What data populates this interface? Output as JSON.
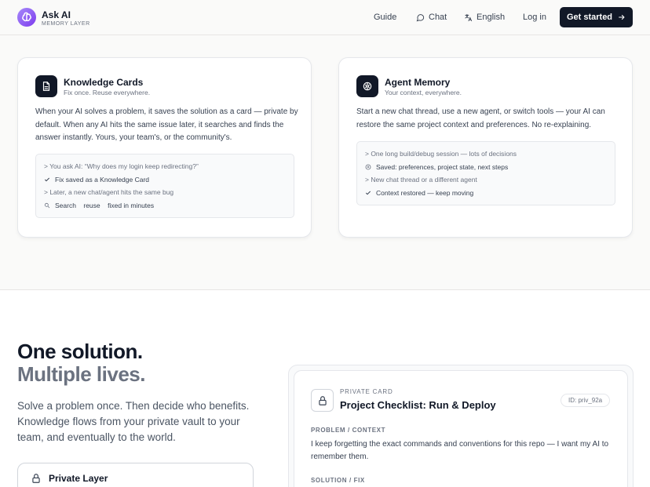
{
  "header": {
    "brand": "Ask AI",
    "brand_sub": "MEMORY LAYER",
    "nav": {
      "guide": "Guide",
      "chat": "Chat",
      "language": "English",
      "login": "Log in",
      "cta": "Get started"
    }
  },
  "features": [
    {
      "title": "Knowledge Cards",
      "subtitle": "Fix once. Reuse everywhere.",
      "description": "When your AI solves a problem, it saves the solution as a card — private by default. When any AI hits the same issue later, it searches and finds the answer instantly. Yours, your team's, or the community's.",
      "log": [
        "> You ask AI: “Why does my login keep redirecting?”",
        "Fix saved as a Knowledge Card",
        "> Later, a new chat/agent hits the same bug",
        "Search    reuse    fixed in minutes"
      ]
    },
    {
      "title": "Agent Memory",
      "subtitle": "Your context, everywhere.",
      "description": "Start a new chat thread, use a new agent, or switch tools — your AI can restore the same project context and preferences. No re-explaining.",
      "log": [
        "> One long build/debug session — lots of decisions",
        "Saved: preferences, project state, next steps",
        "> New chat thread or a different agent",
        "Context restored — keep moving"
      ]
    }
  ],
  "section": {
    "headline_1": "One solution.",
    "headline_2": "Multiple lives.",
    "lede": "Solve a problem once. Then decide who benefits. Knowledge flows from your private vault to your team, and eventually to the world.",
    "layer_title": "Private Layer"
  },
  "private_card": {
    "kicker": "PRIVATE CARD",
    "title": "Project Checklist: Run & Deploy",
    "id": "ID: priv_92a",
    "problem_label": "PROBLEM / CONTEXT",
    "problem_text": "I keep forgetting the exact commands and conventions for this repo — I want my AI to remember them.",
    "solution_label": "SOLUTION / FIX"
  },
  "colors": {
    "accent": "#7c3aed",
    "dark": "#111827",
    "muted": "#6b7280",
    "page_bg": "#fafaf9"
  }
}
